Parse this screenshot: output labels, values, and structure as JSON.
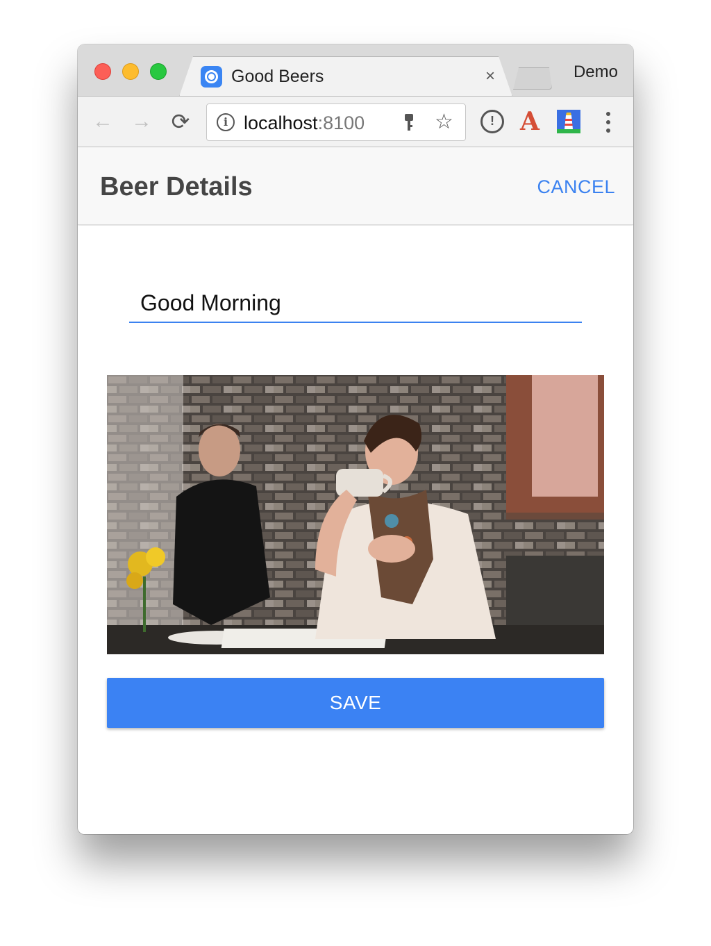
{
  "browser": {
    "tab_title": "Good Beers",
    "tab_close": "×",
    "profile_name": "Demo",
    "url_host": "localhost",
    "url_port": ":8100",
    "nav": {
      "back": "←",
      "forward": "→",
      "reload": "⟳"
    },
    "star": "☆",
    "ext_a": "A"
  },
  "header": {
    "title": "Beer Details",
    "cancel_label": "CANCEL"
  },
  "form": {
    "name_value": "Good Morning"
  },
  "actions": {
    "save_label": "SAVE"
  },
  "colors": {
    "accent": "#3b82f3",
    "title_text": "#454545"
  }
}
